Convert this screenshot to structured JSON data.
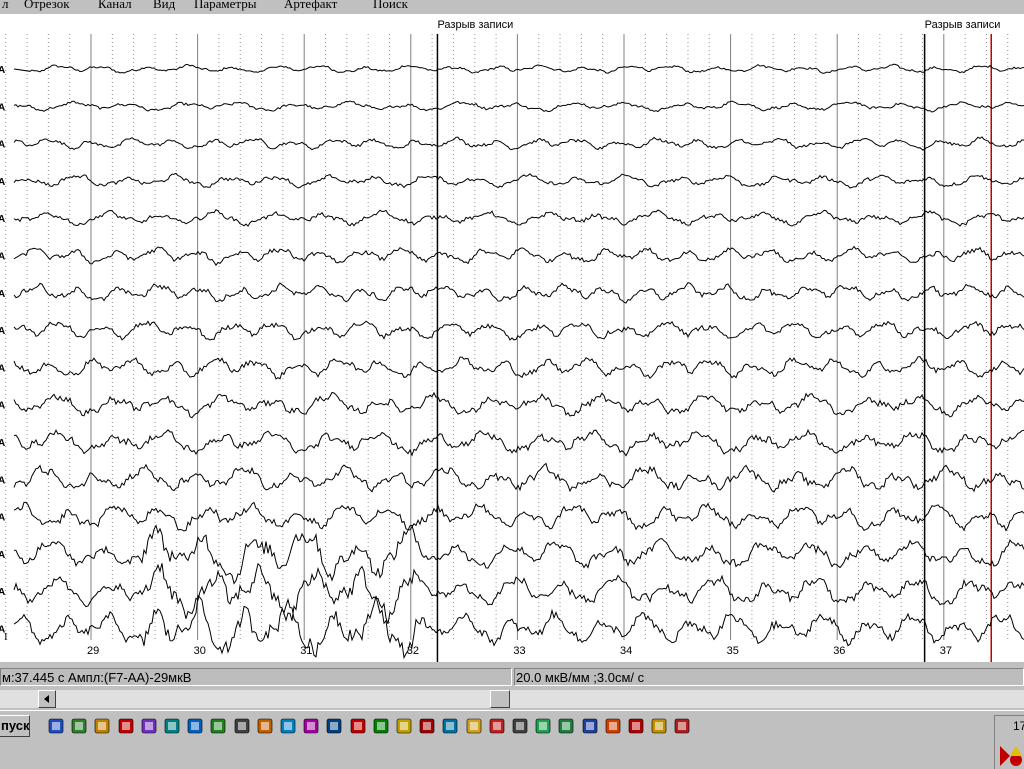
{
  "menu": {
    "items": [
      "л",
      "Отрезок",
      "Канал",
      "Вид",
      "Параметры",
      "Артефакт",
      "Поиск"
    ]
  },
  "eeg": {
    "channel_labels": [
      "A",
      "A",
      "A",
      "A",
      "A",
      "A",
      "A",
      "A",
      "A",
      "A",
      "A",
      "A",
      "A",
      "A",
      "A",
      "A"
    ],
    "record_breaks": [
      {
        "label": "Разрыв записи",
        "time": 32.25
      },
      {
        "label": "Разрыв записи",
        "time": 36.82
      }
    ],
    "time_ticks": [
      "29",
      "30",
      "31",
      "32",
      "33",
      "34",
      "35",
      "36",
      "37"
    ],
    "cursor_time": 37.445,
    "cursor_color": "#c00000",
    "scale_marker": "I"
  },
  "status": {
    "cursor_info": "м:37.445 с Ампл:(F7-AA)-29мкВ",
    "scale_info": "20.0 мкВ/мм ;3.0см/ с"
  },
  "taskbar": {
    "start_label": "пуск",
    "quick_launch": [
      "edit-icon",
      "shortcut-icon",
      "media-player-icon",
      "tools-icon",
      "network-icon",
      "disc-icon",
      "internet-explorer-icon",
      "checkbox-icon",
      "scanner-icon",
      "paint-icon",
      "chart-icon",
      "colorful-icon",
      "book-icon",
      "stamp-icon",
      "display-icon",
      "funnel-icon",
      "reader-icon",
      "globe-icon",
      "folder-icon",
      "image-icon",
      "pen-icon",
      "chemistry-icon",
      "excel-icon",
      "word-icon",
      "picture-icon",
      "acrobat-icon",
      "pencil-icon",
      "notepad-icon"
    ],
    "clock": "17"
  }
}
